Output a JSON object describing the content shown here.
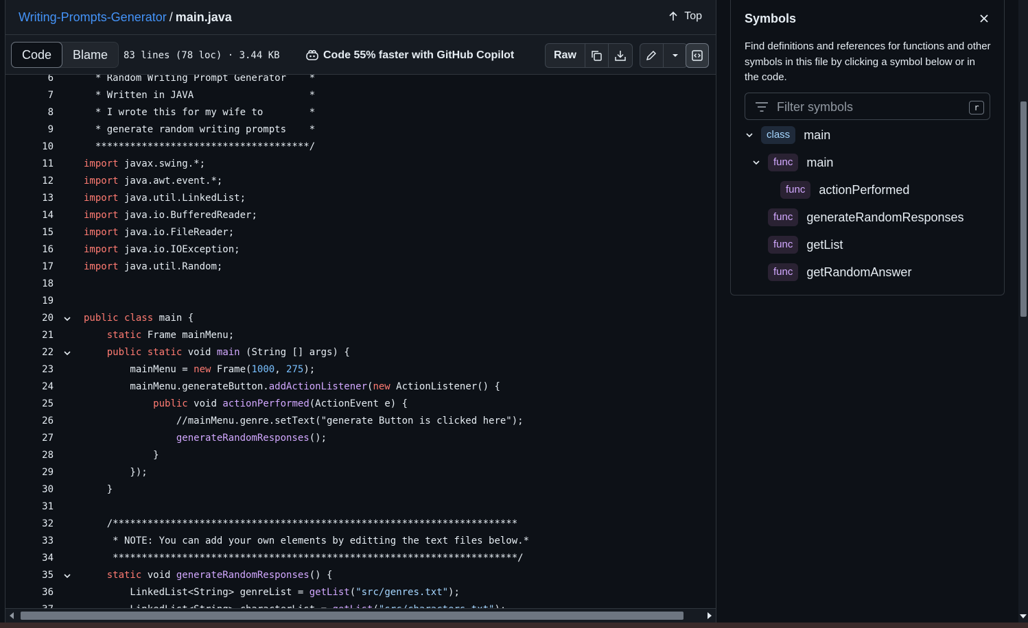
{
  "header": {
    "repo": "Writing-Prompts-Generator",
    "separator": "/",
    "file": "main.java",
    "top_label": "Top"
  },
  "toolbar": {
    "code_label": "Code",
    "blame_label": "Blame",
    "meta": "83 lines (78 loc) · 3.44 KB",
    "copilot_label": "Code 55% faster with GitHub Copilot",
    "raw_label": "Raw"
  },
  "code_lines": [
    {
      "n": "6",
      "fold": false,
      "html": "  * Random Writing Prompt Generator    *"
    },
    {
      "n": "7",
      "fold": false,
      "html": "  * Written in JAVA                    *"
    },
    {
      "n": "8",
      "fold": false,
      "html": "  * I wrote this for my wife to        *"
    },
    {
      "n": "9",
      "fold": false,
      "html": "  * generate random writing prompts    *"
    },
    {
      "n": "10",
      "fold": false,
      "html": "  *************************************/"
    },
    {
      "n": "11",
      "fold": false,
      "html": "<span class=\"kw\">import</span> javax.swing.*;"
    },
    {
      "n": "12",
      "fold": false,
      "html": "<span class=\"kw\">import</span> java.awt.event.*;"
    },
    {
      "n": "13",
      "fold": false,
      "html": "<span class=\"kw\">import</span> java.util.LinkedList;"
    },
    {
      "n": "14",
      "fold": false,
      "html": "<span class=\"kw\">import</span> java.io.BufferedReader;"
    },
    {
      "n": "15",
      "fold": false,
      "html": "<span class=\"kw\">import</span> java.io.FileReader;"
    },
    {
      "n": "16",
      "fold": false,
      "html": "<span class=\"kw\">import</span> java.io.IOException;"
    },
    {
      "n": "17",
      "fold": false,
      "html": "<span class=\"kw\">import</span> java.util.Random;"
    },
    {
      "n": "18",
      "fold": false,
      "html": ""
    },
    {
      "n": "19",
      "fold": false,
      "html": ""
    },
    {
      "n": "20",
      "fold": true,
      "html": "<span class=\"kw\">public</span> <span class=\"kw\">class</span> main {"
    },
    {
      "n": "21",
      "fold": false,
      "html": "    <span class=\"kw\">static</span> Frame mainMenu;"
    },
    {
      "n": "22",
      "fold": true,
      "html": "    <span class=\"kw\">public</span> <span class=\"kw\">static</span> void <span class=\"fn\">main</span> (String [] args) {"
    },
    {
      "n": "23",
      "fold": false,
      "html": "        mainMenu = <span class=\"kw\">new</span> Frame(<span class=\"num\">1000</span>, <span class=\"num\">275</span>);"
    },
    {
      "n": "24",
      "fold": false,
      "html": "        mainMenu.generateButton.<span class=\"fn\">addActionListener</span>(<span class=\"kw\">new</span> ActionListener() {"
    },
    {
      "n": "25",
      "fold": false,
      "html": "            <span class=\"kw\">public</span> void <span class=\"fn\">actionPerformed</span>(ActionEvent e) {"
    },
    {
      "n": "26",
      "fold": false,
      "html": "                //mainMenu.genre.setText(\"generate Button is clicked here\");"
    },
    {
      "n": "27",
      "fold": false,
      "html": "                <span class=\"fn\">generateRandomResponses</span>();"
    },
    {
      "n": "28",
      "fold": false,
      "html": "            }"
    },
    {
      "n": "29",
      "fold": false,
      "html": "        });"
    },
    {
      "n": "30",
      "fold": false,
      "html": "    }"
    },
    {
      "n": "31",
      "fold": false,
      "html": ""
    },
    {
      "n": "32",
      "fold": false,
      "html": "    /**********************************************************************"
    },
    {
      "n": "33",
      "fold": false,
      "html": "     * NOTE: You can add your own elements by editting the text files below.*"
    },
    {
      "n": "34",
      "fold": false,
      "html": "     **********************************************************************/"
    },
    {
      "n": "35",
      "fold": true,
      "html": "    <span class=\"kw\">static</span> void <span class=\"fn\">generateRandomResponses</span>() {"
    },
    {
      "n": "36",
      "fold": false,
      "html": "        LinkedList&lt;String&gt; genreList = <span class=\"fn\">getList</span>(<span class=\"str\">\"src/genres.txt\"</span>);"
    },
    {
      "n": "37",
      "fold": false,
      "html": "        LinkedList&lt;String&gt; characterList = <span class=\"fn\">getList</span>(<span class=\"str\">\"src/characters.txt\"</span>);"
    }
  ],
  "symbols": {
    "title": "Symbols",
    "description": "Find definitions and references for functions and other symbols in this file by clicking a symbol below or in the code.",
    "filter_placeholder": "Filter symbols",
    "filter_shortcut": "r",
    "items": [
      {
        "kind": "class",
        "name": "main",
        "depth": 0,
        "expandable": true
      },
      {
        "kind": "func",
        "name": "main",
        "depth": 1,
        "expandable": true
      },
      {
        "kind": "func",
        "name": "actionPerformed",
        "depth": 2,
        "expandable": false
      },
      {
        "kind": "func",
        "name": "generateRandomResponses",
        "depth": 1,
        "expandable": false
      },
      {
        "kind": "func",
        "name": "getList",
        "depth": 1,
        "expandable": false
      },
      {
        "kind": "func",
        "name": "getRandomAnswer",
        "depth": 1,
        "expandable": false
      }
    ]
  },
  "colors": {
    "background": "#0d1117",
    "link": "#4493f8",
    "keyword": "#ff7b72",
    "function": "#d2a8ff",
    "number": "#79c0ff"
  }
}
